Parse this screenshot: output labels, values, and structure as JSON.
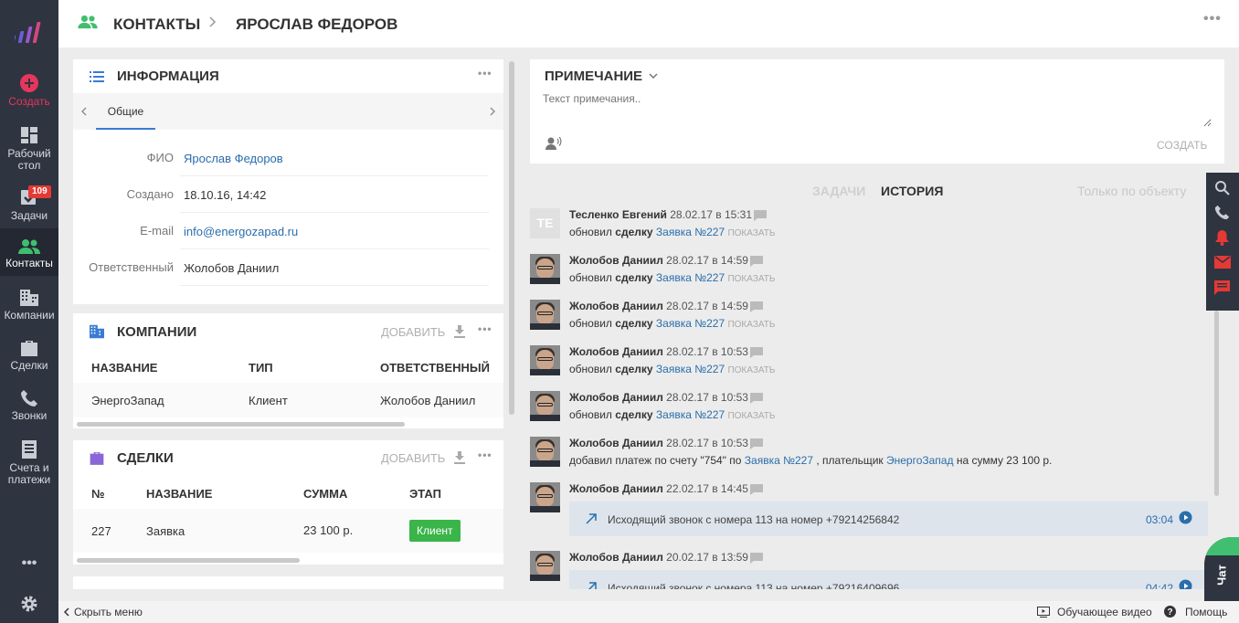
{
  "colors": {
    "sidebar": "#2e3440",
    "accent_green": "#3fbf6f",
    "link": "#2a6eab",
    "badge": "#e53935",
    "stage_green": "#3ab54a"
  },
  "sidebar": {
    "create": "Создать",
    "items": [
      {
        "label": "Рабочий стол",
        "icon": "dashboard-icon"
      },
      {
        "label": "Задачи",
        "icon": "tasks-icon",
        "badge": "109"
      },
      {
        "label": "Контакты",
        "icon": "contacts-icon",
        "active": true
      },
      {
        "label": "Компании",
        "icon": "companies-icon"
      },
      {
        "label": "Сделки",
        "icon": "deals-icon"
      },
      {
        "label": "Звонки",
        "icon": "phone-icon"
      },
      {
        "label": "Счета и платежи",
        "icon": "invoices-icon"
      }
    ],
    "more": "•••"
  },
  "header": {
    "crumb1": "КОНТАКТЫ",
    "crumb2": "ЯРОСЛАВ ФЕДОРОВ"
  },
  "info": {
    "title": "ИНФОРМАЦИЯ",
    "tab": "Общие",
    "fields": [
      {
        "label": "ФИО",
        "value": "Ярослав Федоров"
      },
      {
        "label": "Создано",
        "value": "18.10.16, 14:42"
      },
      {
        "label": "E-mail",
        "value": "info@energozapad.ru"
      },
      {
        "label": "Ответственный",
        "value": "Жолобов Даниил"
      }
    ]
  },
  "companies": {
    "title": "КОМПАНИИ",
    "add": "ДОБАВИТЬ",
    "columns": [
      "НАЗВАНИЕ",
      "ТИП",
      "ОТВЕТСТВЕННЫЙ"
    ],
    "rows": [
      [
        "ЭнергоЗапад",
        "Клиент",
        "Жолобов Даниил"
      ]
    ]
  },
  "deals": {
    "title": "СДЕЛКИ",
    "add": "ДОБАВИТЬ",
    "columns": [
      "№",
      "НАЗВАНИЕ",
      "СУММА",
      "ЭТАП"
    ],
    "rows": [
      [
        "227",
        "Заявка",
        "23 100 р.",
        "Клиент"
      ]
    ]
  },
  "note": {
    "title": "ПРИМЕЧАНИЕ",
    "placeholder": "Текст примечания..",
    "create": "СОЗДАТЬ"
  },
  "history": {
    "tab_tasks": "ЗАДАЧИ",
    "tab_history": "ИСТОРИЯ",
    "filter": "Только по объекту",
    "show": "ПОКАЗАТЬ",
    "items": [
      {
        "author": "Тесленко Евгений",
        "date": "28.02.17 в 15:31",
        "initials": "ТЕ",
        "verb": "обновил",
        "obj": "сделку",
        "link": "Заявка №227"
      },
      {
        "author": "Жолобов Даниил",
        "date": "28.02.17 в 14:59",
        "verb": "обновил",
        "obj": "сделку",
        "link": "Заявка №227"
      },
      {
        "author": "Жолобов Даниил",
        "date": "28.02.17 в 14:59",
        "verb": "обновил",
        "obj": "сделку",
        "link": "Заявка №227"
      },
      {
        "author": "Жолобов Даниил",
        "date": "28.02.17 в 10:53",
        "verb": "обновил",
        "obj": "сделку",
        "link": "Заявка №227"
      },
      {
        "author": "Жолобов Даниил",
        "date": "28.02.17 в 10:53",
        "verb": "обновил",
        "obj": "сделку",
        "link": "Заявка №227"
      }
    ],
    "payment": {
      "author": "Жолобов Даниил",
      "date": "28.02.17 в 10:53",
      "t1": "добавил платеж по счету \"754\" по",
      "link1": "Заявка №227",
      "t2": ", плательщик",
      "link2": "ЭнергоЗапад",
      "t3": "на сумму 23 100 р."
    },
    "calls": [
      {
        "author": "Жолобов Даниил",
        "date": "22.02.17 в 14:45",
        "text": "Исходящий звонок с номера 113 на номер +79214256842",
        "duration": "03:04"
      },
      {
        "author": "Жолобов Даниил",
        "date": "20.02.17 в 13:59",
        "text": "Исходящий звонок с номера 113 на номер +79216409696",
        "duration": "04:42"
      }
    ]
  },
  "chat": "Чат",
  "footer": {
    "hide": "Скрыть меню",
    "video": "Обучающее видео",
    "help": "Помощь"
  }
}
